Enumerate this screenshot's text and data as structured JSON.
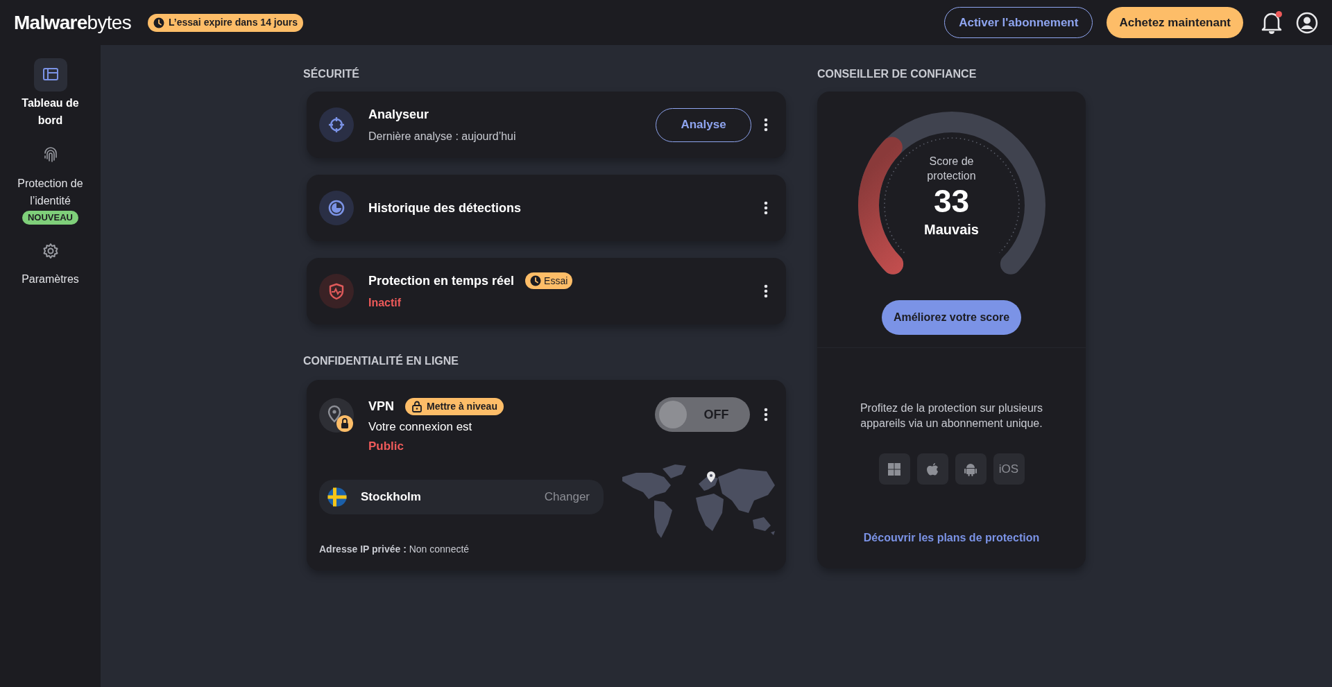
{
  "header": {
    "logo": "**Malware**bytes",
    "trial_badge": "L’essai expire dans 14 jours",
    "activate_button": "Activer l'abonnement",
    "buy_button": "Achetez maintenant",
    "notifications_unread": true
  },
  "sidebar": {
    "items": [
      {
        "kind": "dashboard",
        "label": "Tableau de bord",
        "selected": true
      },
      {
        "kind": "identity",
        "label": "Protection de l’identité",
        "badge": "NOUVEAU",
        "selected": false
      },
      {
        "kind": "settings",
        "label": "Paramètres",
        "selected": false
      }
    ]
  },
  "security": {
    "title": "SÉCURITÉ",
    "cards": [
      {
        "kind": "scanner",
        "title": "Analyseur",
        "subtitle": "Dernière analyse : aujourd’hui",
        "alert": false,
        "button": "Analyse"
      },
      {
        "kind": "history",
        "title": "Historique des détections"
      },
      {
        "kind": "realtime",
        "title": "Protection en temps réel",
        "badge": "Essai",
        "subtitle": "Inactif",
        "alert": true
      }
    ]
  },
  "privacy": {
    "title": "CONFIDENTIALITÉ EN LIGNE",
    "vpn": {
      "title": "VPN",
      "badge": "Mettre à niveau",
      "status_label": "Votre connexion est",
      "status": "Public",
      "alert": true,
      "toggle": {
        "on": false,
        "label": "OFF"
      },
      "location": "Stockholm",
      "change_button": "Changer",
      "ip_label": "Adresse IP privée :",
      "ip_value": "Non connecté"
    }
  },
  "advisor": {
    "title": "CONSEILLER DE CONFIANCE",
    "gauge": {
      "label": "Score de protection",
      "score": "33",
      "rating": "Mauvais",
      "level": 0.33
    },
    "improve_button": "Améliorez votre score",
    "promo": "Profitez de la protection sur plusieurs appareils via un abonnement unique.",
    "platforms": [
      {
        "kind": "windows"
      },
      {
        "kind": "apple"
      },
      {
        "kind": "android"
      },
      {
        "kind": "ios",
        "label": "iOS"
      }
    ],
    "plans_link": "Découvrir les plans de protection"
  }
}
